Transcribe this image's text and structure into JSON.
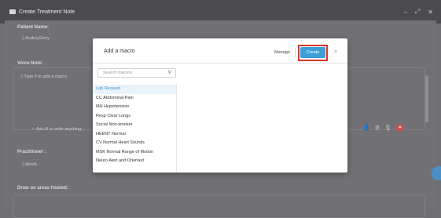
{
  "window": {
    "title": "Create Treatment Note",
    "controls": [
      "–",
      "⤢",
      "✕"
    ]
  },
  "form": {
    "patient_label": "Patient Name:",
    "patient_value": "AudreySorry",
    "voice_label": "Voice Note:",
    "voice_placeholder": "Type # to add a macro",
    "chat_placeholder": "Ask AI to write anything...",
    "practitioner_label": "Practitioner :",
    "practitioner_value": "AlexA.",
    "draw_label": "Draw on areas treated:"
  },
  "modal": {
    "title": "Add a macro",
    "manage_label": "Manage",
    "create_label": "Create",
    "close_label": "×",
    "search_placeholder": "Search macros",
    "items": [
      "Lab Request",
      "CC Abdominal Pain",
      "MH Hypertension",
      "Resp Clear Lungs",
      "Social Non-smoker",
      "HEENT Normal",
      "CV Normal Heart Sounds",
      "MSK Normal Range of Motion",
      "Neuro Alert and Oriented"
    ],
    "selected_index": 0
  },
  "colors": {
    "accent": "#3d9ed8",
    "highlight_outline": "#d9342b",
    "selected_bg": "#e8f3fb"
  }
}
